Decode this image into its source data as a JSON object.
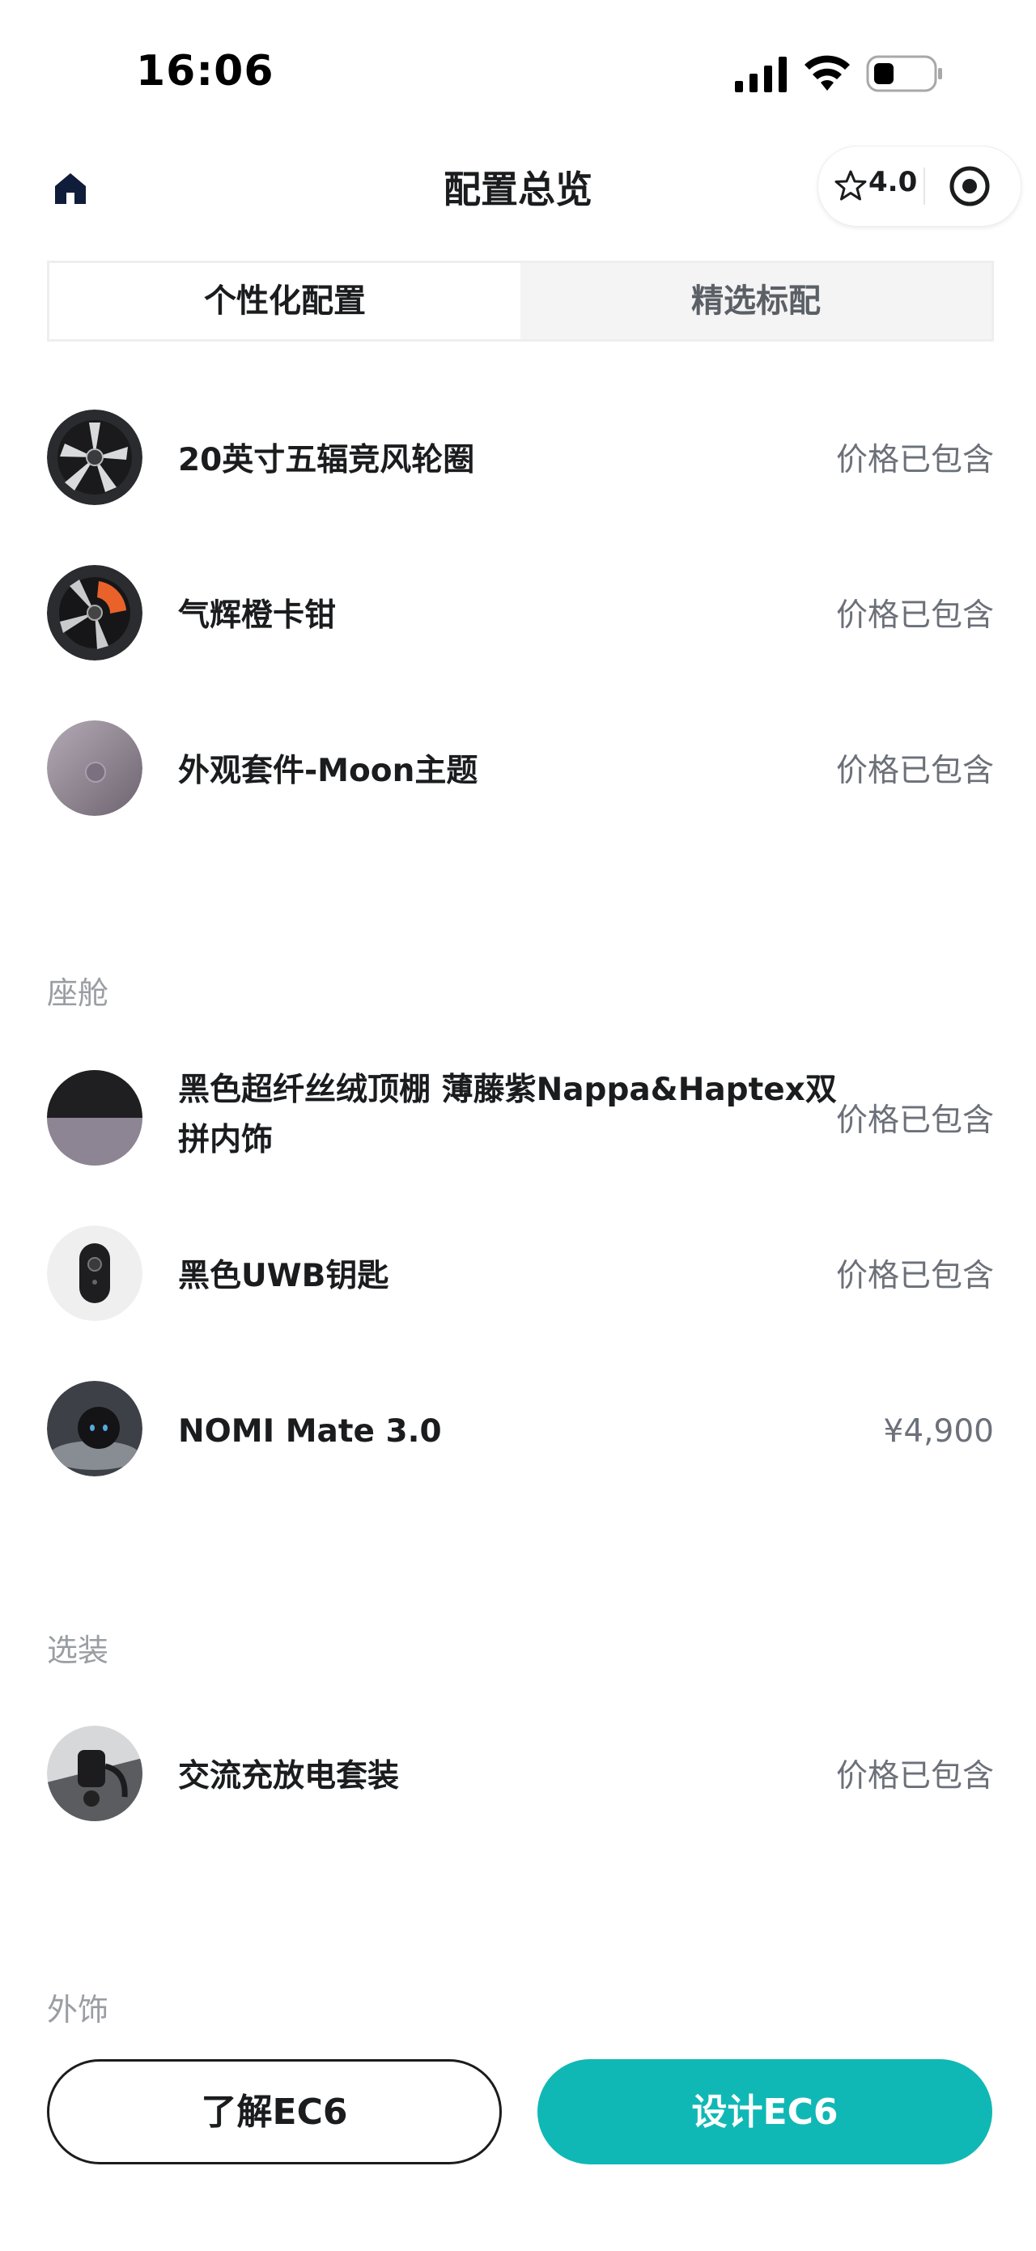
{
  "status_bar": {
    "time": "16:06"
  },
  "nav": {
    "title": "配置总览",
    "rating": "4.0"
  },
  "tabs": [
    {
      "label": "个性化配置",
      "active": true
    },
    {
      "label": "精选标配",
      "active": false
    }
  ],
  "exterior_items": [
    {
      "name": "20英寸五辐竞风轮圈",
      "price": "价格已包含",
      "icon": "wheel-thumb"
    },
    {
      "name": "气辉橙卡钳",
      "price": "价格已包含",
      "icon": "caliper-thumb"
    },
    {
      "name": "外观套件-Moon主题",
      "price": "价格已包含",
      "icon": "moon-theme-thumb"
    }
  ],
  "cabin": {
    "title": "座舱",
    "items": [
      {
        "name": "黑色超纤丝绒顶棚 薄藤紫Nappa&Haptex双拼内饰",
        "price": "价格已包含",
        "icon": "interior-thumb"
      },
      {
        "name": "黑色UWB钥匙",
        "price": "价格已包含",
        "icon": "key-thumb"
      },
      {
        "name": "NOMI Mate 3.0",
        "price": "¥4,900",
        "icon": "nomi-thumb"
      }
    ]
  },
  "options": {
    "title": "选装",
    "items": [
      {
        "name": "交流充放电套装",
        "price": "价格已包含",
        "icon": "charger-thumb"
      }
    ]
  },
  "exterior_trim": {
    "title": "外饰"
  },
  "buttons": {
    "learn": "了解EC6",
    "design": "设计EC6"
  },
  "colors": {
    "accent": "#10b8b5",
    "text": "#1b1c1e",
    "muted": "#9a9da3"
  }
}
